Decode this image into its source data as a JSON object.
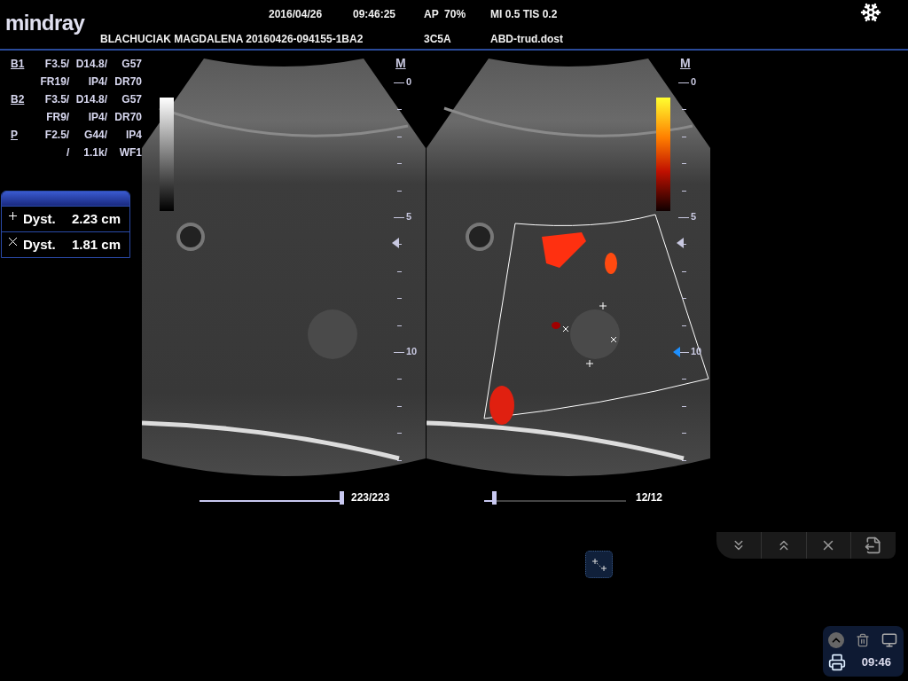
{
  "header": {
    "logo": "mindray",
    "date": "2016/04/26",
    "time": "09:46:25",
    "ap": "AP  70%",
    "mi_tis": "MI 0.5 TIS 0.2",
    "patient": "BLACHUCIAK MAGDALENA 20160426-094155-1BA2",
    "probe": "3C5A",
    "exam": "ABD-trud.dost"
  },
  "parameters": [
    {
      "mode": "B1",
      "rows": [
        [
          "F3.5/",
          "D14.8/",
          "G57"
        ],
        [
          "FR19/",
          "IP4/",
          "DR70"
        ]
      ]
    },
    {
      "mode": "B2",
      "rows": [
        [
          "F3.5/",
          "D14.8/",
          "G57"
        ],
        [
          "FR9/",
          "IP4/",
          "DR70"
        ]
      ]
    },
    {
      "mode": "P",
      "rows": [
        [
          "F2.5/",
          "G44/",
          "IP4"
        ],
        [
          "/",
          "1.1k/",
          "WF1"
        ]
      ]
    }
  ],
  "measurements": [
    {
      "kind": "plus",
      "label": "Dyst.",
      "value": "2.23 cm"
    },
    {
      "kind": "cross",
      "label": "Dyst.",
      "value": "1.81 cm"
    }
  ],
  "images": [
    {
      "kind": "b-mode",
      "scale": {
        "title": "M",
        "labels": [
          "0",
          "5",
          "10"
        ]
      },
      "cine": {
        "counter": "223/223",
        "level": 1
      }
    },
    {
      "kind": "color-doppler",
      "scale": {
        "title": "M",
        "labels": [
          "0",
          "5",
          "10"
        ]
      },
      "cine": {
        "counter": "12/12",
        "level": 0.07
      }
    }
  ],
  "tray": {
    "clock": "09:46"
  }
}
